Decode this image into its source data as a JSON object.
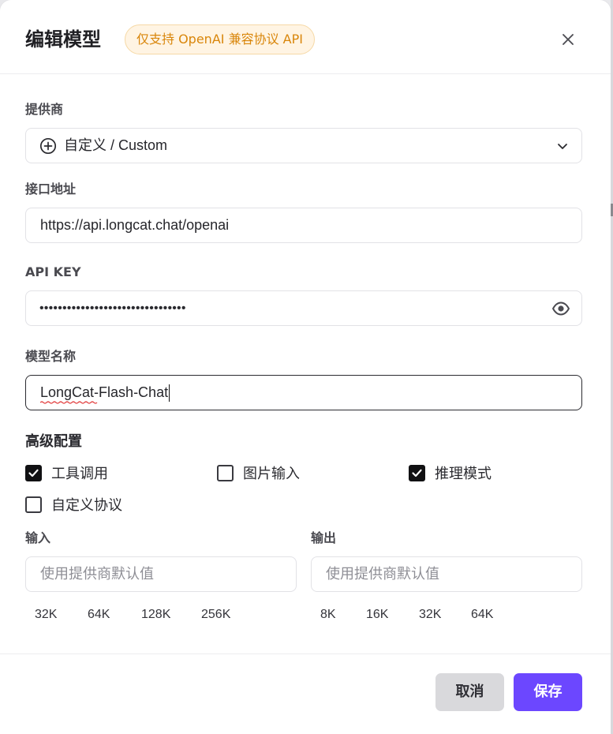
{
  "header": {
    "title": "编辑模型",
    "badge": "仅支持 OpenAI 兼容协议 API"
  },
  "provider": {
    "label": "提供商",
    "value": "自定义 / Custom"
  },
  "endpoint": {
    "label": "接口地址",
    "value": "https://api.longcat.chat/openai"
  },
  "api_key": {
    "label": "API KEY",
    "masked_value": "••••••••••••••••••••••••••••••••"
  },
  "model_name": {
    "label": "模型名称",
    "value": "LongCat-Flash-Chat"
  },
  "advanced": {
    "title": "高级配置",
    "options": [
      {
        "label": "工具调用",
        "checked": true
      },
      {
        "label": "图片输入",
        "checked": false
      },
      {
        "label": "推理模式",
        "checked": true
      },
      {
        "label": "自定义协议",
        "checked": false
      }
    ]
  },
  "input_limit": {
    "label": "输入",
    "placeholder": "使用提供商默认值",
    "presets": [
      "32K",
      "64K",
      "128K",
      "256K"
    ]
  },
  "output_limit": {
    "label": "输出",
    "placeholder": "使用提供商默认值",
    "presets": [
      "8K",
      "16K",
      "32K",
      "64K"
    ]
  },
  "footer": {
    "cancel_label": "取消",
    "save_label": "保存"
  },
  "colors": {
    "accent": "#6c47ff",
    "badge_text": "#d9860b",
    "badge_bg": "#fff4e3"
  }
}
